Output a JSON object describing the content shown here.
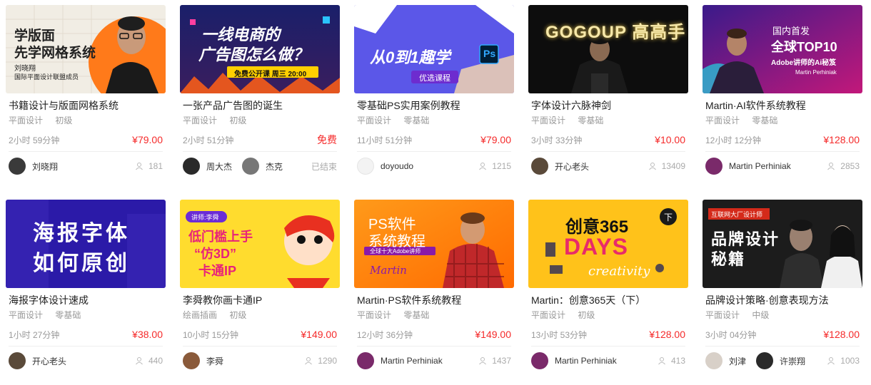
{
  "courses": [
    {
      "title": "书籍设计与版面网格系统",
      "category": "平面设计",
      "level": "初级",
      "duration": "2小时 59分钟",
      "price": "¥79.00",
      "teachers": [
        {
          "name": "刘晓翔",
          "avatar_color": "#3a3a3a"
        }
      ],
      "right": "181",
      "right_is_count": true,
      "thumb": {
        "lines": [
          "学版面",
          "先学网格系统"
        ],
        "sub1": "刘晓翔",
        "sub2": "国际平面设计联盟成员"
      }
    },
    {
      "title": "一张产品广告图的诞生",
      "category": "平面设计",
      "level": "初级",
      "duration": "2小时 51分钟",
      "price": "免费",
      "teachers": [
        {
          "name": "周大杰",
          "avatar_color": "#2a2a2a"
        },
        {
          "name": "杰克",
          "avatar_color": "#777777"
        }
      ],
      "right": "已结束",
      "right_is_count": false,
      "thumb": {
        "lines": [
          "一线电商的",
          "广告图怎么做？"
        ],
        "sub1": "免费公开课 周三 20:00"
      }
    },
    {
      "title": "零基础PS实用案例教程",
      "category": "平面设计",
      "level": "零基础",
      "duration": "11小时 51分钟",
      "price": "¥79.00",
      "teachers": [
        {
          "name": "doyoudo",
          "avatar_color": "#f3f3f3"
        }
      ],
      "right": "1215",
      "right_is_count": true,
      "thumb": {
        "lines": [
          "从0到1趣学",
          "Ps"
        ],
        "sub1": "优选课程"
      }
    },
    {
      "title": "字体设计六脉神剑",
      "category": "平面设计",
      "level": "零基础",
      "duration": "3小时 33分钟",
      "price": "¥10.00",
      "teachers": [
        {
          "name": "开心老头",
          "avatar_color": "#5a4a3a"
        }
      ],
      "right": "13409",
      "right_is_count": true,
      "thumb": {
        "lines": [
          "GOGOUP 高高手"
        ]
      }
    },
    {
      "title": "Martin·AI软件系统教程",
      "category": "平面设计",
      "level": "零基础",
      "duration": "12小时 12分钟",
      "price": "¥128.00",
      "teachers": [
        {
          "name": "Martin Perhiniak",
          "avatar_color": "#7a2a6a"
        }
      ],
      "right": "2853",
      "right_is_count": true,
      "thumb": {
        "lines": [
          "国内首发",
          "全球TOP10",
          "Adobe讲师的Ai秘笈"
        ],
        "sub1": "Martin Perhiniak"
      }
    },
    {
      "title": "海报字体设计速成",
      "category": "平面设计",
      "level": "零基础",
      "duration": "1小时 27分钟",
      "price": "¥38.00",
      "teachers": [
        {
          "name": "开心老头",
          "avatar_color": "#5a4a3a"
        }
      ],
      "right": "440",
      "right_is_count": true,
      "thumb": {
        "lines": [
          "海报字体",
          "如何原创"
        ]
      }
    },
    {
      "title": "李舜教你画卡通IP",
      "category": "绘画插画",
      "level": "初级",
      "duration": "10小时 15分钟",
      "price": "¥149.00",
      "teachers": [
        {
          "name": "李舜",
          "avatar_color": "#8a5a3a"
        }
      ],
      "right": "1290",
      "right_is_count": true,
      "thumb": {
        "lines": [
          "低门槛上手",
          "“仿3D”",
          "卡通IP"
        ],
        "sub1": "讲师:李舜"
      }
    },
    {
      "title": "Martin·PS软件系统教程",
      "category": "平面设计",
      "level": "零基础",
      "duration": "12小时 36分钟",
      "price": "¥149.00",
      "teachers": [
        {
          "name": "Martin Perhiniak",
          "avatar_color": "#7a2a6a"
        }
      ],
      "right": "1437",
      "right_is_count": true,
      "thumb": {
        "lines": [
          "PS软件",
          "系统教程"
        ],
        "sub1": "全球十大Adobe讲师",
        "sub2": "Martin"
      }
    },
    {
      "title": "Martin：创意365天（下）",
      "category": "平面设计",
      "level": "初级",
      "duration": "13小时 53分钟",
      "price": "¥128.00",
      "teachers": [
        {
          "name": "Martin Perhiniak",
          "avatar_color": "#7a2a6a"
        }
      ],
      "right": "413",
      "right_is_count": true,
      "thumb": {
        "lines": [
          "创意365",
          "DAYS",
          "creativity"
        ],
        "sub1": "下"
      }
    },
    {
      "title": "品牌设计策略·创意表现方法",
      "category": "平面设计",
      "level": "中级",
      "duration": "3小时 04分钟",
      "price": "¥128.00",
      "teachers": [
        {
          "name": "刘津",
          "avatar_color": "#d8d0c8"
        },
        {
          "name": "许崇翔",
          "avatar_color": "#2a2a2a"
        }
      ],
      "right": "1003",
      "right_is_count": true,
      "thumb": {
        "lines": [
          "品牌设计",
          "秘籍"
        ],
        "sub1": "互联网大厂设计师"
      }
    }
  ],
  "colors": {
    "price": "#f52a2a",
    "muted": "#999999",
    "title": "#222222"
  }
}
